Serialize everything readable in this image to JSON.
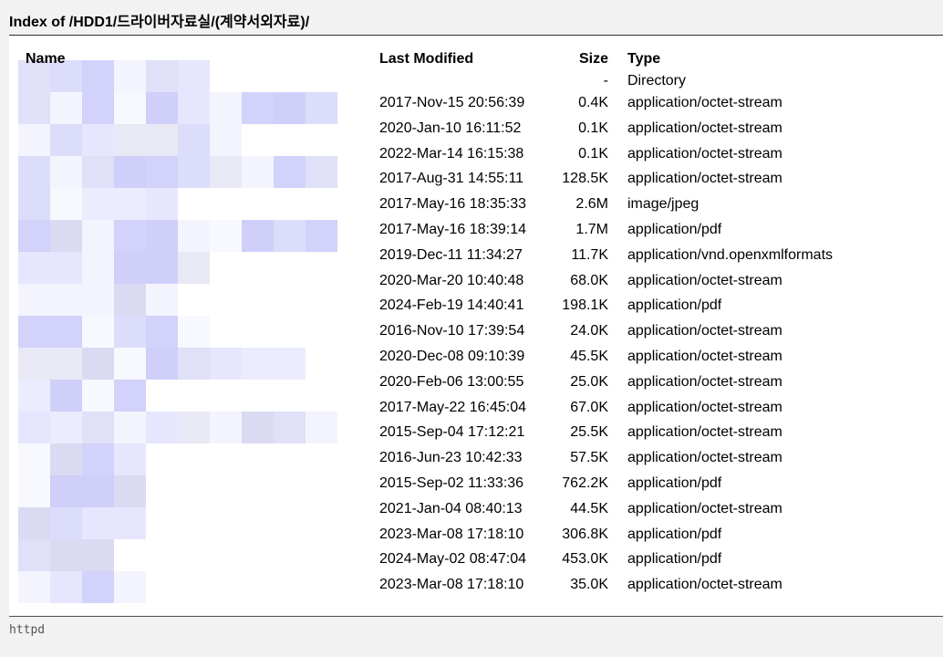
{
  "page": {
    "title": "Index of /HDD1/드라이버자료실/(계약서외자료)/",
    "footer": "httpd"
  },
  "table": {
    "headers": {
      "name": "Name",
      "last_modified": "Last Modified",
      "size": "Size",
      "type": "Type"
    },
    "parent_row": {
      "size": "-",
      "type": "Directory"
    },
    "rows": [
      {
        "modified": "2017-Nov-15 20:56:39",
        "size": "0.4K",
        "type": "application/octet-stream"
      },
      {
        "modified": "2020-Jan-10 16:11:52",
        "size": "0.1K",
        "type": "application/octet-stream"
      },
      {
        "modified": "2022-Mar-14 16:15:38",
        "size": "0.1K",
        "type": "application/octet-stream"
      },
      {
        "modified": "2017-Aug-31 14:55:11",
        "size": "128.5K",
        "type": "application/octet-stream"
      },
      {
        "modified": "2017-May-16 18:35:33",
        "size": "2.6M",
        "type": "image/jpeg"
      },
      {
        "modified": "2017-May-16 18:39:14",
        "size": "1.7M",
        "type": "application/pdf"
      },
      {
        "modified": "2019-Dec-11 11:34:27",
        "size": "11.7K",
        "type": "application/vnd.openxmlformats"
      },
      {
        "modified": "2020-Mar-20 10:40:48",
        "size": "68.0K",
        "type": "application/octet-stream"
      },
      {
        "modified": "2024-Feb-19 14:40:41",
        "size": "198.1K",
        "type": "application/pdf"
      },
      {
        "modified": "2016-Nov-10 17:39:54",
        "size": "24.0K",
        "type": "application/octet-stream"
      },
      {
        "modified": "2020-Dec-08 09:10:39",
        "size": "45.5K",
        "type": "application/octet-stream"
      },
      {
        "modified": "2020-Feb-06 13:00:55",
        "size": "25.0K",
        "type": "application/octet-stream"
      },
      {
        "modified": "2017-May-22 16:45:04",
        "size": "67.0K",
        "type": "application/octet-stream"
      },
      {
        "modified": "2015-Sep-04 17:12:21",
        "size": "25.5K",
        "type": "application/octet-stream"
      },
      {
        "modified": "2016-Jun-23 10:42:33",
        "size": "57.5K",
        "type": "application/octet-stream"
      },
      {
        "modified": "2015-Sep-02 11:33:36",
        "size": "762.2K",
        "type": "application/pdf"
      },
      {
        "modified": "2021-Jan-04 08:40:13",
        "size": "44.5K",
        "type": "application/octet-stream"
      },
      {
        "modified": "2023-Mar-08 17:18:10",
        "size": "306.8K",
        "type": "application/pdf"
      },
      {
        "modified": "2024-May-02 08:47:04",
        "size": "453.0K",
        "type": "application/pdf"
      },
      {
        "modified": "2023-Mar-08 17:18:10",
        "size": "35.0K",
        "type": "application/octet-stream"
      }
    ]
  },
  "colors": {
    "background": "#f2f2f2",
    "listing_background": "#ffffff",
    "redaction_tint": "#d9d9ff"
  }
}
